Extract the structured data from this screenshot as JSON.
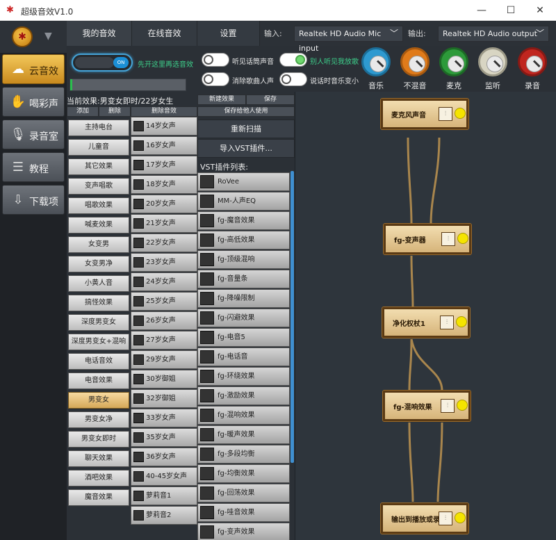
{
  "window": {
    "title": "超级音效V1.0",
    "minimize_symbol": "—",
    "maximize_symbol": "☐",
    "close_symbol": "✕"
  },
  "nav": {
    "items": [
      {
        "label": "云音效",
        "icon": "cloud-icon"
      },
      {
        "label": "喝彩声",
        "icon": "applause-icon"
      },
      {
        "label": "录音室",
        "icon": "microphone-icon"
      },
      {
        "label": "教程",
        "icon": "tutorial-icon"
      },
      {
        "label": "下载项",
        "icon": "download-icon"
      }
    ]
  },
  "tabs": [
    "我的音效",
    "在线音效",
    "设置"
  ],
  "io": {
    "input_label": "输入:",
    "input_value": "Realtek HD Audio Mic input",
    "output_label": "输出:",
    "output_value": "Realtek HD Audio output"
  },
  "toggle": {
    "state": "ON",
    "hint": "先开这里再选音效"
  },
  "progress": {
    "value": 0.02
  },
  "options": [
    {
      "label": "听见话筒声音",
      "on": false
    },
    {
      "label": "别人听见我放歌",
      "on": true
    },
    {
      "label": "消除歌曲人声",
      "on": false
    },
    {
      "label": "说话时音乐变小",
      "on": false
    }
  ],
  "dials": [
    {
      "label": "音乐",
      "color": "#2e9ad0"
    },
    {
      "label": "不混音",
      "color": "#e07b1a"
    },
    {
      "label": "麦克",
      "color": "#2d9a3a"
    },
    {
      "label": "监听",
      "color": "#d8d5c3"
    },
    {
      "label": "录音",
      "color": "#c0261f"
    }
  ],
  "current_effect": "当前效果:男变女即时/22岁女生",
  "buttons": {
    "add": "添加",
    "delete": "删除",
    "delete_effect": "删除音效",
    "new_effect": "新建效果",
    "save": "保存",
    "save_for_others": "保存给他人使用",
    "rescan": "重新扫描",
    "import_vst": "导入VST插件..."
  },
  "effects": [
    "主持电台",
    "儿童音",
    "其它效果",
    "变声唱歌",
    "唱歌效果",
    "喊麦效果",
    "女变男",
    "女变男净",
    "小黄人音",
    "搞怪效果",
    "深度男变女",
    "深度男变女+混响",
    "电话音效",
    "电音效果",
    "男变女",
    "男变女净",
    "男变女即时",
    "聊天效果",
    "酒吧效果",
    "魔音效果"
  ],
  "selected_effect": "男变女",
  "presets": [
    "14岁女声",
    "16岁女声",
    "17岁女声",
    "18岁女声",
    "20岁女声",
    "21岁女声",
    "22岁女声",
    "23岁女声",
    "24岁女声",
    "25岁女声",
    "26岁女声",
    "27岁女声",
    "29岁女声",
    "30岁御姐",
    "32岁御姐",
    "33岁女声",
    "35岁女声",
    "36岁女声",
    "40-45岁女声",
    "萝莉音1",
    "萝莉音2"
  ],
  "vst_header": "VST插件列表:",
  "vst_plugins": [
    "RoVee",
    "MM-人声EQ",
    "fg-魔音效果",
    "fg-高低效果",
    "fg-顶级混响",
    "fg-音量条",
    "fg-降噪限制",
    "fg-闪避效果",
    "fg-电音5",
    "fg-电话音",
    "fg-环绕效果",
    "fg-激励效果",
    "fg-混响效果",
    "fg-暖声效果",
    "fg-多段均衡",
    "fg-均衡效果",
    "fg-回荡效果",
    "fg-哇音效果",
    "fg-变声效果"
  ],
  "chain": [
    {
      "label": "麦克风声音"
    },
    {
      "label": "fg-变声器"
    },
    {
      "label": "净化权杖1"
    },
    {
      "label": "fg-混响效果"
    },
    {
      "label": "输出到播放或录音"
    }
  ],
  "eq_symbol": "⫶"
}
